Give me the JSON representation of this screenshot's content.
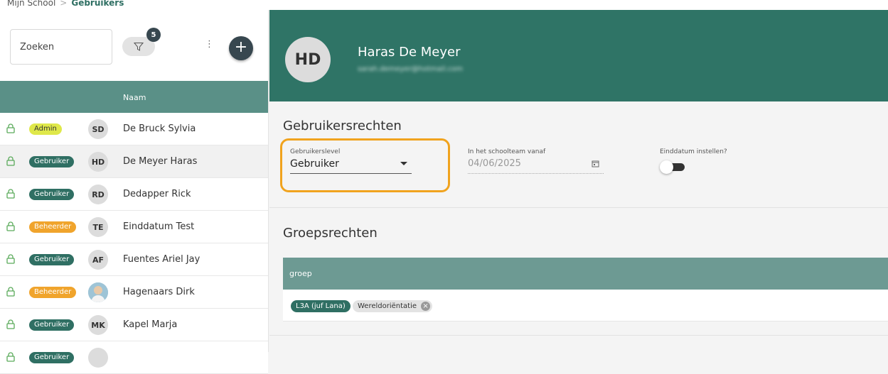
{
  "breadcrumb": {
    "root": "Mijn School",
    "separator": ">",
    "current": "Gebruikers"
  },
  "toolbar": {
    "search_placeholder": "Zoeken",
    "filter_count": "5",
    "kebab": "⋮",
    "add": "+"
  },
  "table": {
    "col_name": "Naam"
  },
  "users": [
    {
      "role": "Admin",
      "role_type": "admin",
      "initials": "SD",
      "name": "De Bruck Sylvia",
      "selected": false
    },
    {
      "role": "Gebruiker",
      "role_type": "gebruiker",
      "initials": "HD",
      "name": "De Meyer Haras",
      "selected": true
    },
    {
      "role": "Gebruiker",
      "role_type": "gebruiker",
      "initials": "RD",
      "name": "Dedapper Rick",
      "selected": false
    },
    {
      "role": "Beheerder",
      "role_type": "beheerder",
      "initials": "TE",
      "name": "Einddatum Test",
      "selected": false
    },
    {
      "role": "Gebruiker",
      "role_type": "gebruiker",
      "initials": "AF",
      "name": "Fuentes Ariel Jay",
      "selected": false
    },
    {
      "role": "Beheerder",
      "role_type": "beheerder",
      "initials": "",
      "name": "Hagenaars Dirk",
      "selected": false,
      "photo": true
    },
    {
      "role": "Gebruiker",
      "role_type": "gebruiker",
      "initials": "MK",
      "name": "Kapel Marja",
      "selected": false
    },
    {
      "role": "Gebruiker",
      "role_type": "gebruiker",
      "initials": "",
      "name": "",
      "selected": false
    }
  ],
  "profile": {
    "initials": "HD",
    "name": "Haras De Meyer",
    "email": "sarah.demeyer@hotmail.com"
  },
  "rights": {
    "title": "Gebruikersrechten",
    "level_label": "Gebruikerslevel",
    "level_value": "Gebruiker",
    "since_label": "In het schoolteam vanaf",
    "since_value": "04/06/2025",
    "enddate_label": "Einddatum instellen?",
    "enddate_on": false
  },
  "groups": {
    "title": "Groepsrechten",
    "col": "groep",
    "chip1": "L3A (juf Lana)",
    "chip2": "Wereldoriëntatie",
    "chip2_remove": "×"
  },
  "colors": {
    "accent": "#2f7466",
    "admin": "#dfe84a",
    "gebruiker": "#2f6f63",
    "beheerder": "#f0a42c",
    "highlight": "#f0a31e"
  }
}
